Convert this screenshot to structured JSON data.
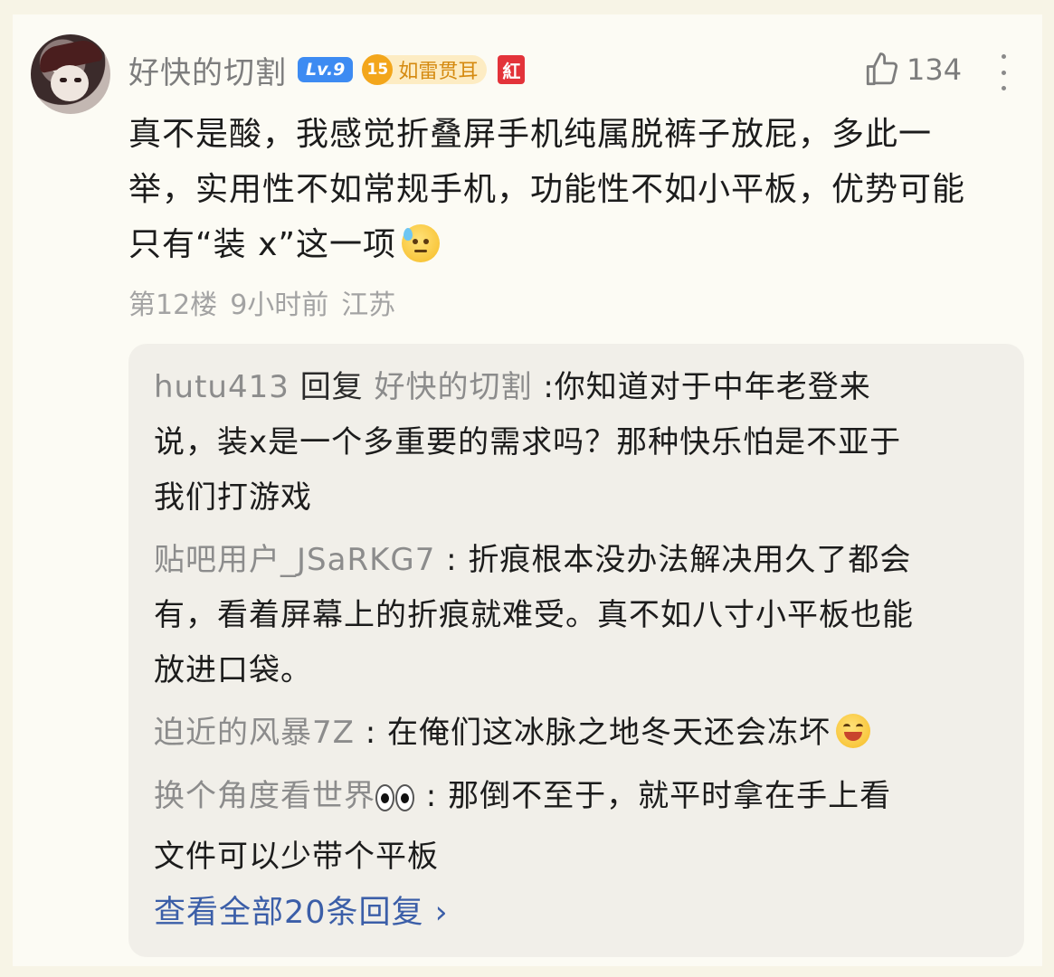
{
  "comment": {
    "username": "好快的切割",
    "level_badge": "Lv.9",
    "honor_level": "15",
    "honor_title": "如雷贯耳",
    "red_badge": "紅",
    "like_count": "134",
    "content_line1": "真不是酸，我感觉折叠屏手机纯属脱裤子放屁，多此一",
    "content_line2": "举，实用性不如常规手机，功能性不如小平板，优势可能",
    "content_line3": "只有“装 x”这一项",
    "floor": "第12楼",
    "time": "9小时前",
    "location": "江苏"
  },
  "replies": [
    {
      "user": "hutu413",
      "reply_word": "回复",
      "target": "好快的切割",
      "line1": ":你知道对于中年老登来",
      "line2": "说，装x是一个多重要的需求吗？那种快乐怕是不亚于",
      "line3": "我们打游戏"
    },
    {
      "user": "贴吧用户_JSaRKG7",
      "line1": " : 折痕根本没办法解决用久了都会",
      "line2": "有，看着屏幕上的折痕就难受。真不如八寸小平板也能",
      "line3": "放进口袋。"
    },
    {
      "user": "迫近的风暴7Z",
      "line1": " : 在俺们这冰脉之地冬天还会冻坏"
    },
    {
      "user": "换个角度看世界",
      "line1": " : 那倒不至于，就平时拿在手上看",
      "line2": "文件可以少带个平板"
    }
  ],
  "view_all": "查看全部20条回复 ›",
  "colors": {
    "background": "#f7f4e6",
    "username_gray": "#7d7d7d",
    "link_blue": "#3b5ea8",
    "level_blue": "#3d8bf2",
    "honor_orange": "#f3a61b"
  }
}
